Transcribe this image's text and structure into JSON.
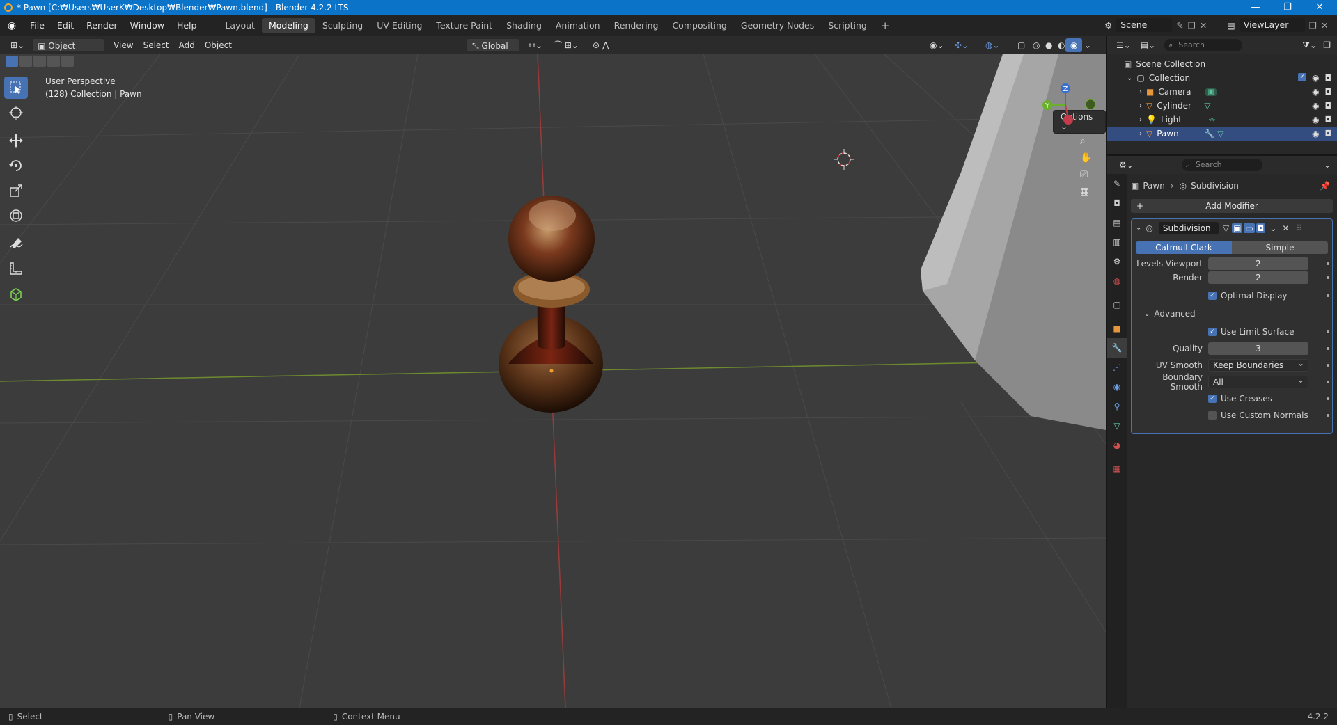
{
  "window": {
    "title": "* Pawn [C:₩Users₩UserK₩Desktop₩Blender₩Pawn.blend] - Blender 4.2.2 LTS"
  },
  "menu": [
    "File",
    "Edit",
    "Render",
    "Window",
    "Help"
  ],
  "workspaces": [
    "Layout",
    "Modeling",
    "Sculpting",
    "UV Editing",
    "Texture Paint",
    "Shading",
    "Animation",
    "Rendering",
    "Compositing",
    "Geometry Nodes",
    "Scripting"
  ],
  "active_workspace": "Modeling",
  "scene": {
    "name": "Scene",
    "view_layer": "ViewLayer"
  },
  "viewport_header": {
    "mode": "Object Mode",
    "menus": [
      "View",
      "Select",
      "Add",
      "Object"
    ],
    "transform_orientation": "Global",
    "options": "Options"
  },
  "viewport": {
    "perspective": "User Perspective",
    "collection_info": "(128) Collection | Pawn"
  },
  "gizmo": {
    "z": "Z",
    "y": "Y"
  },
  "outliner": {
    "search_placeholder": "Search",
    "root": "Scene Collection",
    "collection": "Collection",
    "items": [
      "Camera",
      "Cylinder",
      "Light",
      "Pawn"
    ]
  },
  "properties": {
    "search_placeholder": "Search",
    "breadcrumb_object": "Pawn",
    "breadcrumb_modifier": "Subdivision",
    "add_modifier": "Add Modifier",
    "modifier_name": "Subdivision",
    "algorithm_options": [
      "Catmull-Clark",
      "Simple"
    ],
    "levels_viewport_label": "Levels Viewport",
    "levels_viewport": "2",
    "render_label": "Render",
    "render": "2",
    "optimal_display": "Optimal Display",
    "advanced": "Advanced",
    "use_limit_surface": "Use Limit Surface",
    "quality_label": "Quality",
    "quality": "3",
    "uv_smooth_label": "UV Smooth",
    "uv_smooth": "Keep Boundaries",
    "boundary_smooth_label": "Boundary Smooth",
    "boundary_smooth": "All",
    "use_creases": "Use Creases",
    "use_custom_normals": "Use Custom Normals"
  },
  "statusbar": {
    "select": "Select",
    "pan": "Pan View",
    "context": "Context Menu",
    "version": "4.2.2"
  }
}
